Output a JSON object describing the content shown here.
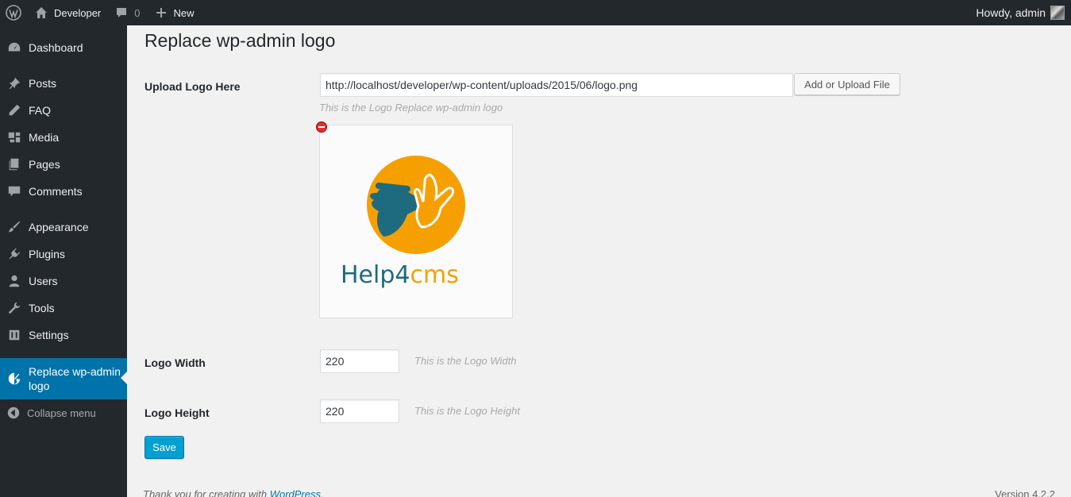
{
  "admin_bar": {
    "site_name": "Developer",
    "comments_count": "0",
    "new_label": "New",
    "howdy": "Howdy, admin"
  },
  "sidebar": {
    "items": [
      {
        "label": "Dashboard",
        "icon": "dashboard-icon"
      },
      {
        "label": "Posts",
        "icon": "pushpin-icon"
      },
      {
        "label": "FAQ",
        "icon": "pencil-icon"
      },
      {
        "label": "Media",
        "icon": "media-icon"
      },
      {
        "label": "Pages",
        "icon": "pages-icon"
      },
      {
        "label": "Comments",
        "icon": "comment-icon"
      },
      {
        "label": "Appearance",
        "icon": "paintbrush-icon"
      },
      {
        "label": "Plugins",
        "icon": "plugin-icon"
      },
      {
        "label": "Users",
        "icon": "users-icon"
      },
      {
        "label": "Tools",
        "icon": "wrench-icon"
      },
      {
        "label": "Settings",
        "icon": "settings-icon"
      },
      {
        "label": "Replace wp-admin logo",
        "icon": "palette-icon",
        "current": true
      }
    ],
    "collapse_label": "Collapse menu"
  },
  "main": {
    "title": "Replace wp-admin logo",
    "upload": {
      "label": "Upload Logo Here",
      "value": "http://localhost/developer/wp-content/uploads/2015/06/logo.png",
      "button": "Add or Upload File",
      "description": "This is the Logo Replace wp-admin logo"
    },
    "logo_preview": {
      "brand_text_1": "Help4",
      "brand_text_2": "cms"
    },
    "width": {
      "label": "Logo Width",
      "value": "220",
      "description": "This is the Logo Width"
    },
    "height": {
      "label": "Logo Height",
      "value": "220",
      "description": "This is the Logo Height"
    },
    "save_label": "Save"
  },
  "footer": {
    "thanks_prefix": "Thank you for creating with ",
    "thanks_link": "WordPress",
    "thanks_suffix": ".",
    "version": "Version 4.2.2"
  },
  "colors": {
    "admin_dark": "#23282d",
    "accent": "#0073aa",
    "primary_button": "#00a0d2",
    "logo_orange": "#f5a000",
    "logo_teal": "#1e6a7e"
  }
}
